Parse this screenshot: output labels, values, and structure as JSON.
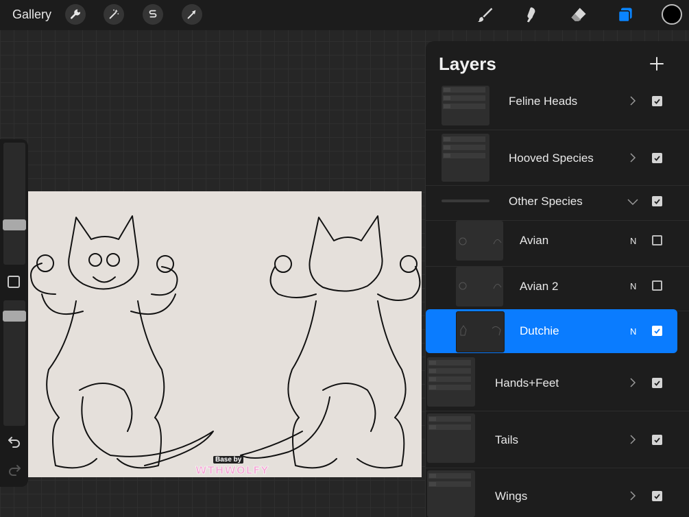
{
  "toolbar": {
    "gallery_label": "Gallery",
    "left_tools": [
      "wrench-icon",
      "magic-wand-icon",
      "selection-icon",
      "transform-arrow-icon"
    ],
    "right_tools": [
      "brush-icon",
      "smudge-icon",
      "eraser-icon",
      "layers-icon"
    ],
    "current_color": "#000000"
  },
  "layers": {
    "title": "Layers",
    "items": [
      {
        "name": "Feline Heads",
        "type": "group",
        "collapsed": true,
        "visible": true
      },
      {
        "name": "Hooved Species",
        "type": "group",
        "collapsed": true,
        "visible": true
      },
      {
        "name": "Other Species",
        "type": "group",
        "collapsed": false,
        "visible": true
      },
      {
        "name": "Avian",
        "type": "layer",
        "blend": "N",
        "visible": false
      },
      {
        "name": "Avian 2",
        "type": "layer",
        "blend": "N",
        "visible": false
      },
      {
        "name": "Dutchie",
        "type": "layer",
        "blend": "N",
        "visible": true,
        "selected": true
      },
      {
        "name": "Hands+Feet",
        "type": "group",
        "collapsed": true,
        "visible": true
      },
      {
        "name": "Tails",
        "type": "group",
        "collapsed": true,
        "visible": true
      },
      {
        "name": "Wings",
        "type": "group",
        "collapsed": true,
        "visible": true
      }
    ]
  },
  "canvas": {
    "watermark_top": "Base by",
    "watermark_bottom": "WTHWOLFY"
  },
  "colors": {
    "accent": "#0a7cff",
    "canvas_bg": "#e5e0db",
    "panel_bg": "#1d1d1d"
  }
}
